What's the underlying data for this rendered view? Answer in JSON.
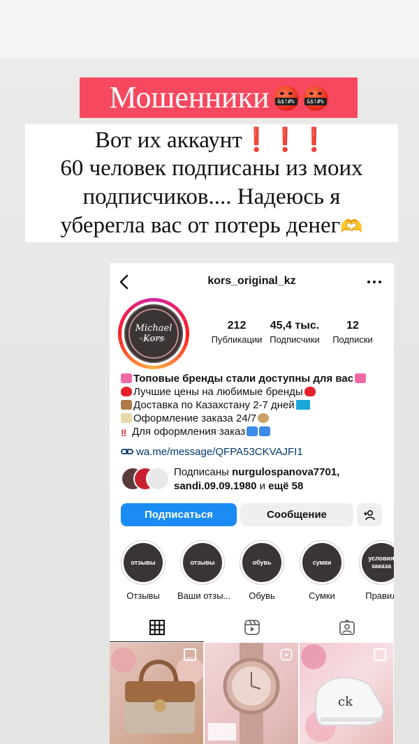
{
  "story": {
    "title": "Мошенники",
    "emoji_bar_text": "&$!#%",
    "line1": "Вот их аккаунт",
    "line1_marks": "❗️❗️❗️",
    "line2": "60 человек подписаны из моих",
    "line3": "подписчиков.... Надеюсь я",
    "line4": "уберегла вас от потерь денег",
    "line4_emoji": "🫶"
  },
  "profile": {
    "username": "kors_original_kz",
    "avatar_logo": "Michael Kors",
    "avatar_logo_sub": "ORIGINAL",
    "stats": [
      {
        "value": "212",
        "label": "Публикации"
      },
      {
        "value": "45,4 тыс.",
        "label": "Подписчики"
      },
      {
        "value": "12",
        "label": "Подписки"
      }
    ],
    "bio": {
      "line1": "Топовые бренды стали доступны для вас",
      "line2": "Лучшие цены на любимые бренды",
      "line3": "Доставка по Казахстану 2-7 дней",
      "line4": "Оформление заказа 24/7",
      "line5": "Для оформления заказ"
    },
    "link": "wa.me/message/QFPA53CKVAJFI1",
    "followed_by": {
      "prefix": "Подписаны ",
      "user1": "nurgulospanova7701,",
      "user2": "sandi.09.09.1980",
      "middle": " и ",
      "suffix": "ещё 58"
    },
    "buttons": {
      "follow": "Подписаться",
      "message": "Сообщение"
    },
    "highlights": [
      {
        "cover": "отзывы",
        "label": "Отзывы"
      },
      {
        "cover": "отзывы",
        "label": "Ваши отзы..."
      },
      {
        "cover": "обувь",
        "label": "Обувь"
      },
      {
        "cover": "сумки",
        "label": "Сумки"
      },
      {
        "cover": "условия заказа",
        "label": "Правил"
      }
    ]
  },
  "colors": {
    "banner": "#f6495f",
    "follow_button": "#1a8cf4",
    "link": "#00376b"
  }
}
